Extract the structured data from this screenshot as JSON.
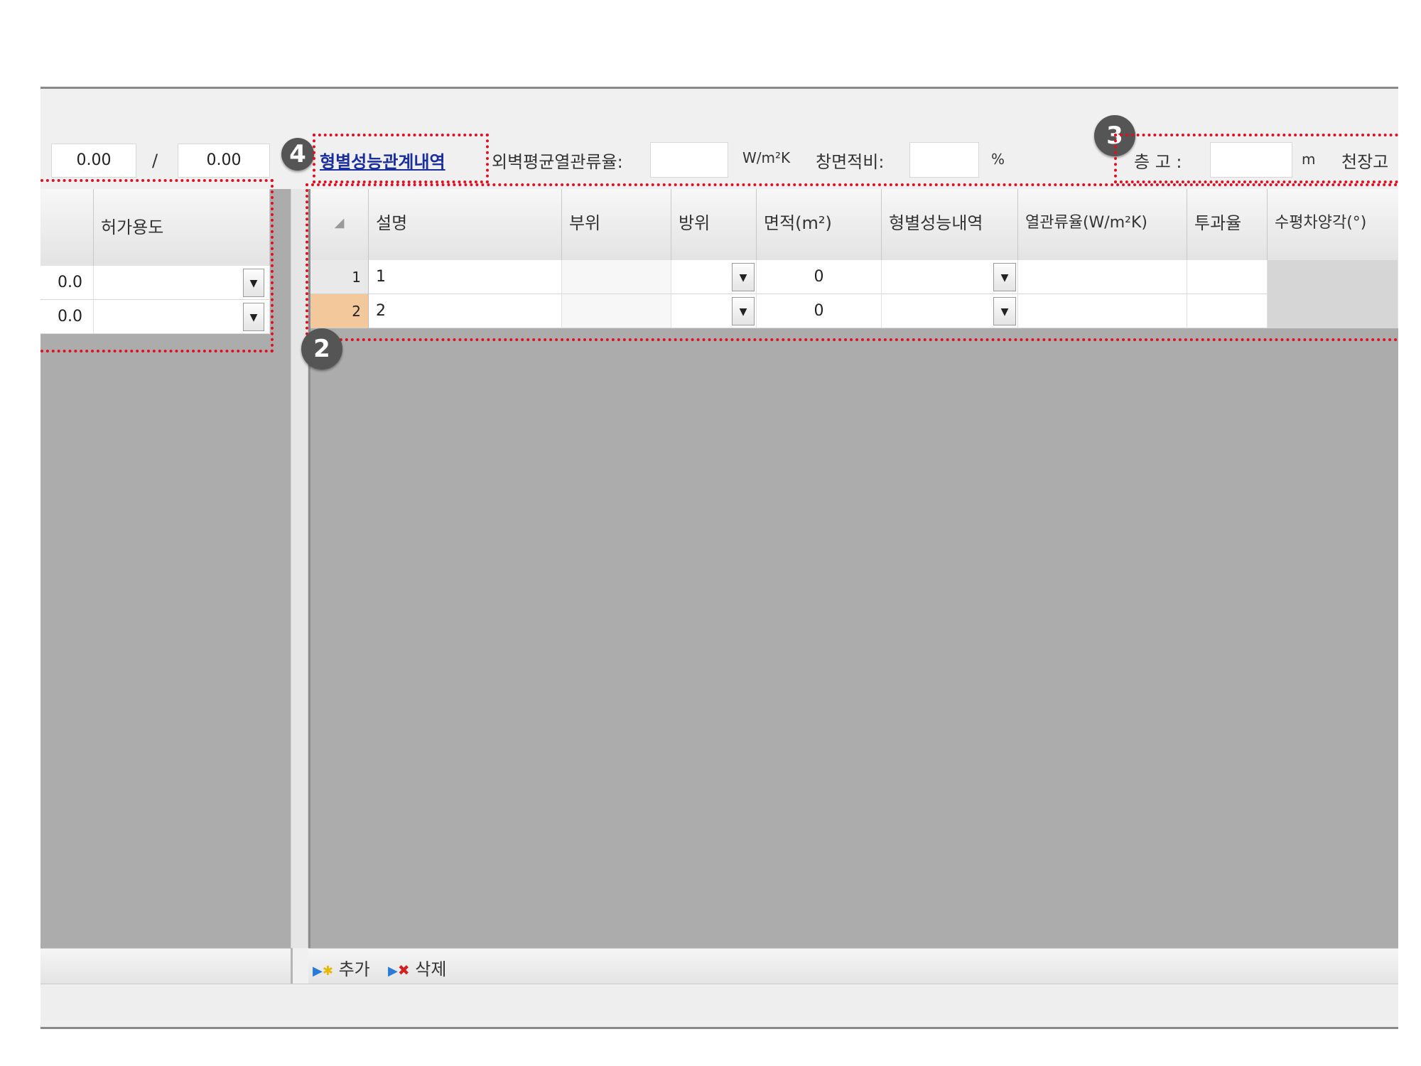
{
  "left_panel": {
    "value_a": "0.00",
    "separator": "/",
    "value_b": "0.00",
    "column_header": "허가용도",
    "rows": [
      {
        "value": "0.0"
      },
      {
        "value": "0.0"
      }
    ]
  },
  "toolbar": {
    "link_label": "형별성능관계내역",
    "avg_u_label": "외벽평균열관류율:",
    "avg_u_value": "",
    "avg_u_unit": "W/m²K",
    "window_ratio_label": "창면적비:",
    "window_ratio_value": "",
    "window_ratio_unit": "%",
    "floor_height_label": "층 고 :",
    "floor_height_value": "",
    "floor_height_unit": "m",
    "ceiling_label": "천장고"
  },
  "grid": {
    "columns": [
      "설명",
      "부위",
      "방위",
      "면적(m²)",
      "형별성능내역",
      "열관류율(W/m²K)",
      "투과율",
      "수평차양각(°)"
    ],
    "rows": [
      {
        "num": "1",
        "desc": "1",
        "part": "",
        "direction": "",
        "area": "0",
        "perf": "",
        "u_value": "",
        "trans": ""
      },
      {
        "num": "2",
        "desc": "2",
        "part": "",
        "direction": "",
        "area": "0",
        "perf": "",
        "u_value": "",
        "trans": ""
      }
    ],
    "selected_row": 2
  },
  "footer": {
    "add_label": "추가",
    "delete_label": "삭제"
  },
  "badges": [
    "2",
    "3",
    "4"
  ],
  "colors": {
    "annotation": "#e01020",
    "link": "#1a2f9c",
    "selected_row": "#f3c89a",
    "empty_area": "#acacac"
  }
}
